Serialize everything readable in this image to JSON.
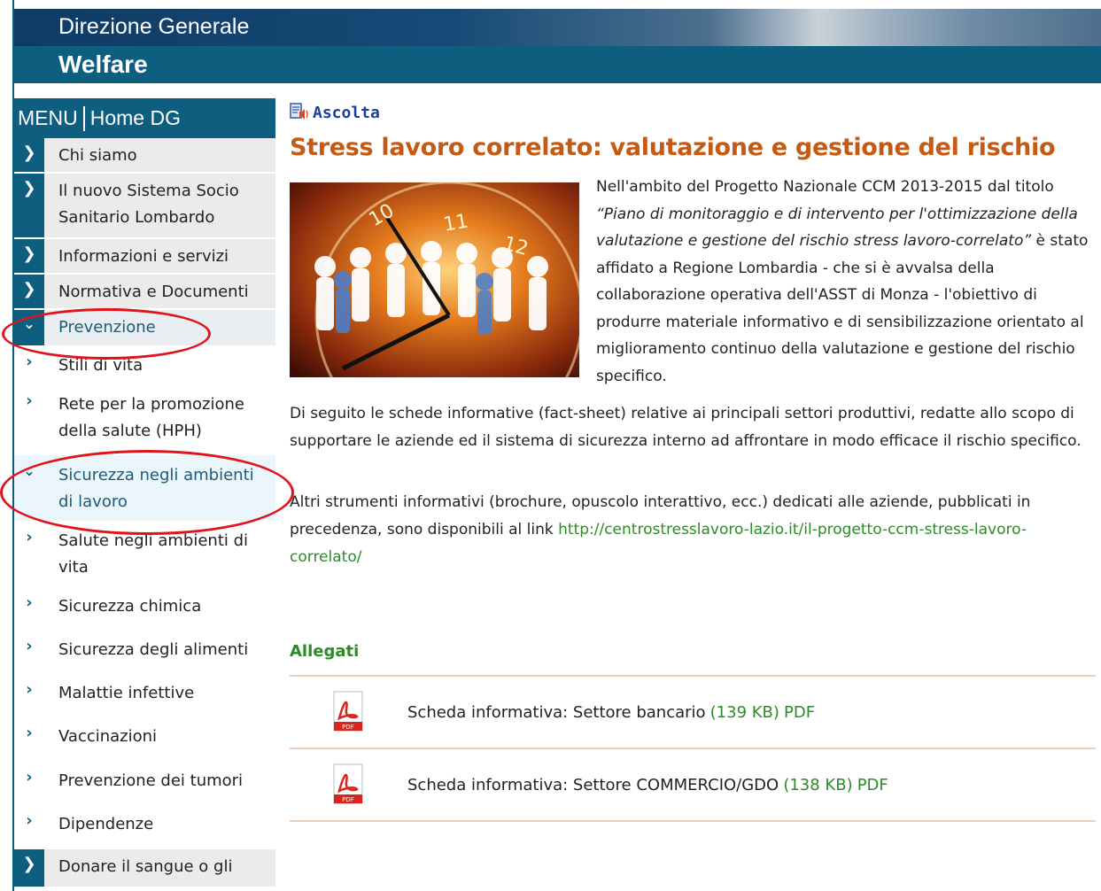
{
  "header": {
    "line1": "Direzione Generale",
    "line2": "Welfare"
  },
  "sidebar": {
    "menu_label": "MENU",
    "home_label": "Home DG",
    "items": [
      {
        "label": "Chi siamo"
      },
      {
        "label": "Il nuovo Sistema Socio Sanitario Lombardo"
      },
      {
        "label": "Informazioni e servizi"
      },
      {
        "label": "Normativa e Documenti"
      },
      {
        "label": "Prevenzione"
      }
    ],
    "subitems": [
      {
        "label": "Stili di vita"
      },
      {
        "label": "Rete per la promozione della salute (HPH)"
      },
      {
        "label": "Sicurezza negli ambienti di lavoro"
      },
      {
        "label": "Salute negli ambienti di vita"
      },
      {
        "label": "Sicurezza chimica"
      },
      {
        "label": "Sicurezza degli alimenti"
      },
      {
        "label": "Malattie infettive"
      },
      {
        "label": "Vaccinazioni"
      },
      {
        "label": "Prevenzione dei tumori"
      },
      {
        "label": "Dipendenze"
      }
    ],
    "last_item": {
      "label": "Donare il sangue o gli"
    }
  },
  "content": {
    "ascolta": "Ascolta",
    "title": "Stress lavoro correlato: valutazione e gestione del rischio",
    "intro_part1": "Nell'ambito del Progetto Nazionale CCM 2013-2015 dal titolo",
    "intro_italic": "“Piano di monitoraggio e di intervento per l'ottimizzazione della valutazione e gestione del rischio stress lavoro-correlato”",
    "intro_part2": " è stato affidato a Regione Lombardia - che si è avvalsa della collaborazione operativa dell'ASST di Monza - l'obiettivo di produrre materiale informativo e di sensibilizzazione orientato al miglioramento continuo della valutazione e gestione del rischio specifico.",
    "para1": "Di seguito le schede informative (fact-sheet) relative ai principali settori produttivi, redatte allo scopo di supportare le aziende ed il sistema di sicurezza interno ad affrontare in modo efficace il rischio specifico.",
    "para2_text": "Altri strumenti informativi (brochure, opuscolo interattivo, ecc.) dedicati alle aziende, pubblicati in precedenza, sono disponibili al  link ",
    "para2_link": "http://centrostresslavoro-lazio.it/il-progetto-ccm-stress-lavoro-correlato/",
    "allegati": "Allegati",
    "attachments": [
      {
        "name": "Scheda informativa: Settore bancario",
        "size": "(139 KB)",
        "type": "PDF"
      },
      {
        "name": "Scheda informativa: Settore COMMERCIO/GDO",
        "size": "(138 KB)",
        "type": "PDF"
      }
    ]
  },
  "colors": {
    "brand_teal": "#0e5f7f",
    "title_orange": "#c65a13",
    "link_green": "#2d8a29",
    "annotation_red": "#e2141b"
  }
}
